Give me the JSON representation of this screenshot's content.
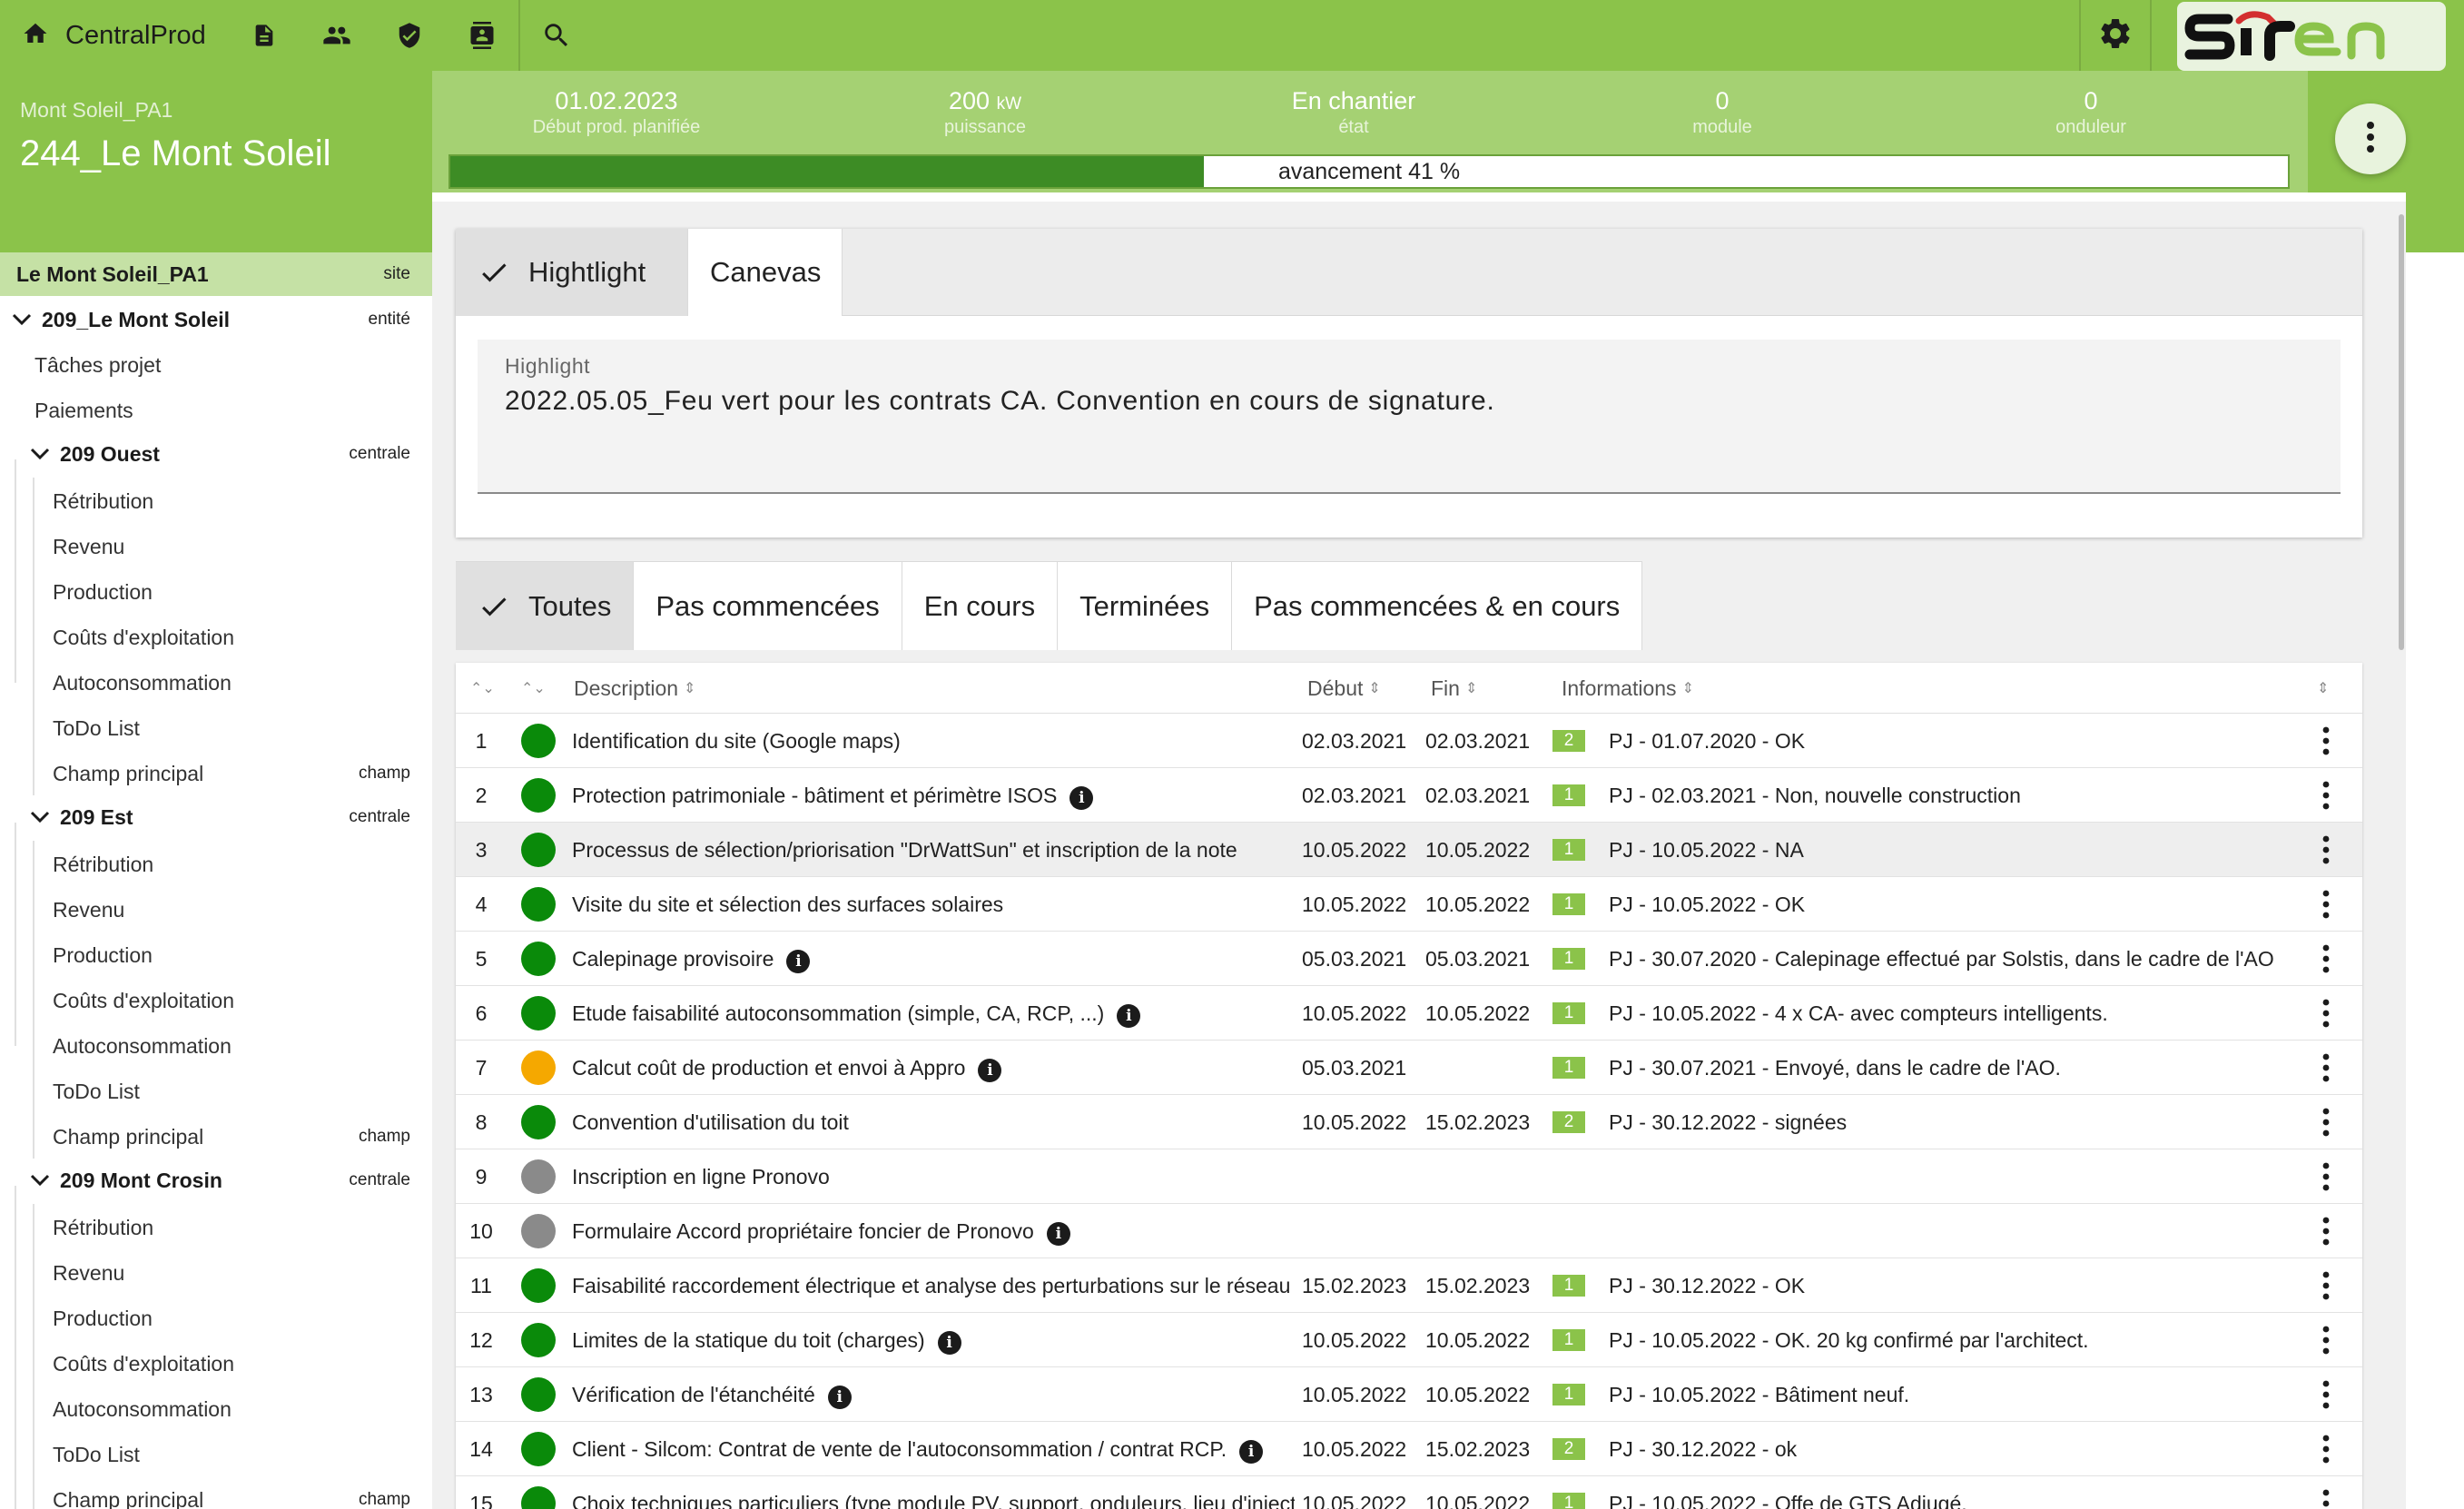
{
  "app": {
    "name": "CentralProd",
    "logo_text": "Siren"
  },
  "header": {
    "subtitle": "Mont Soleil_PA1",
    "title": "244_Le Mont Soleil"
  },
  "stats": [
    {
      "value": "01.02.2023",
      "unit": "",
      "label": "Début prod. planifiée"
    },
    {
      "value": "200",
      "unit": "kW",
      "label": "puissance"
    },
    {
      "value": "En chantier",
      "unit": "",
      "label": "état"
    },
    {
      "value": "0",
      "unit": "",
      "label": "module"
    },
    {
      "value": "0",
      "unit": "",
      "label": "onduleur"
    }
  ],
  "progress": {
    "label": "avancement 41 %",
    "value": 0.41
  },
  "sidebar": {
    "site": {
      "label": "Le Mont Soleil_PA1",
      "tag": "site"
    },
    "entity": {
      "label": "209_Le Mont Soleil",
      "tag": "entité"
    },
    "entity_items": [
      "Tâches projet",
      "Paiements"
    ],
    "centrales": [
      {
        "label": "209 Ouest",
        "tag": "centrale",
        "items": [
          "Rétribution",
          "Revenu",
          "Production",
          "Coûts d'exploitation",
          "Autoconsommation",
          "ToDo List"
        ],
        "champ": {
          "label": "Champ principal",
          "tag": "champ"
        }
      },
      {
        "label": "209 Est",
        "tag": "centrale",
        "items": [
          "Rétribution",
          "Revenu",
          "Production",
          "Coûts d'exploitation",
          "Autoconsommation",
          "ToDo List"
        ],
        "champ": {
          "label": "Champ principal",
          "tag": "champ"
        }
      },
      {
        "label": "209 Mont Crosin",
        "tag": "centrale",
        "items": [
          "Rétribution",
          "Revenu",
          "Production",
          "Coûts d'exploitation",
          "Autoconsommation",
          "ToDo List"
        ],
        "champ": {
          "label": "Champ principal",
          "tag": "champ"
        }
      }
    ]
  },
  "highlight_tabs": {
    "hightlight": "Hightlight",
    "canevas": "Canevas"
  },
  "highlight": {
    "label": "Highlight",
    "value": "2022.05.05_Feu vert pour les contrats CA. Convention en cours de signature."
  },
  "filter_tabs": [
    "Toutes",
    "Pas commencées",
    "En cours",
    "Terminées",
    "Pas commencées & en cours"
  ],
  "table": {
    "headers": {
      "description": "Description",
      "debut": "Début",
      "fin": "Fin",
      "informations": "Informations"
    },
    "status_colors": {
      "done": "#0a8a0a",
      "in_progress": "#f5a800",
      "not_started": "#8a8a8a"
    },
    "rows": [
      {
        "num": "1",
        "status": "done",
        "description": "Identification du site (Google maps)",
        "info_icon": false,
        "debut": "02.03.2021",
        "fin": "02.03.2021",
        "badge": "2",
        "info": "PJ - 01.07.2020 - OK"
      },
      {
        "num": "2",
        "status": "done",
        "description": "Protection patrimoniale - bâtiment et périmètre ISOS",
        "info_icon": true,
        "debut": "02.03.2021",
        "fin": "02.03.2021",
        "badge": "1",
        "info": "PJ - 02.03.2021 - Non, nouvelle construction"
      },
      {
        "num": "3",
        "status": "done",
        "description": "Processus de sélection/priorisation \"DrWattSun\" et inscription de la note",
        "info_icon": false,
        "debut": "10.05.2022",
        "fin": "10.05.2022",
        "badge": "1",
        "info": "PJ - 10.05.2022 - NA"
      },
      {
        "num": "4",
        "status": "done",
        "description": "Visite du site et sélection des surfaces solaires",
        "info_icon": false,
        "debut": "10.05.2022",
        "fin": "10.05.2022",
        "badge": "1",
        "info": "PJ - 10.05.2022 - OK"
      },
      {
        "num": "5",
        "status": "done",
        "description": "Calepinage provisoire",
        "info_icon": true,
        "debut": "05.03.2021",
        "fin": "05.03.2021",
        "badge": "1",
        "info": "PJ - 30.07.2020 - Calepinage effectué par Solstis, dans le cadre de l'AO"
      },
      {
        "num": "6",
        "status": "done",
        "description": "Etude faisabilité autoconsommation (simple, CA, RCP, ...)",
        "info_icon": true,
        "debut": "10.05.2022",
        "fin": "10.05.2022",
        "badge": "1",
        "info": "PJ - 10.05.2022 - 4 x CA- avec compteurs intelligents."
      },
      {
        "num": "7",
        "status": "in_progress",
        "description": "Calcut coût de production et envoi à Appro",
        "info_icon": true,
        "debut": "05.03.2021",
        "fin": "",
        "badge": "1",
        "info": "PJ - 30.07.2021 - Envoyé, dans le cadre de l'AO."
      },
      {
        "num": "8",
        "status": "done",
        "description": "Convention d'utilisation du toit",
        "info_icon": false,
        "debut": "10.05.2022",
        "fin": "15.02.2023",
        "badge": "2",
        "info": "PJ - 30.12.2022 - signées"
      },
      {
        "num": "9",
        "status": "not_started",
        "description": "Inscription en ligne Pronovo",
        "info_icon": false,
        "debut": "",
        "fin": "",
        "badge": "",
        "info": ""
      },
      {
        "num": "10",
        "status": "not_started",
        "description": "Formulaire Accord propriétaire foncier de Pronovo",
        "info_icon": true,
        "debut": "",
        "fin": "",
        "badge": "",
        "info": ""
      },
      {
        "num": "11",
        "status": "done",
        "description": "Faisabilité raccordement électrique et analyse des perturbations sur le réseau é",
        "info_icon": false,
        "debut": "15.02.2023",
        "fin": "15.02.2023",
        "badge": "1",
        "info": "PJ - 30.12.2022 - OK"
      },
      {
        "num": "12",
        "status": "done",
        "description": "Limites de la statique du toit (charges)",
        "info_icon": true,
        "debut": "10.05.2022",
        "fin": "10.05.2022",
        "badge": "1",
        "info": "PJ - 10.05.2022 - OK. 20 kg confirmé par l'architect."
      },
      {
        "num": "13",
        "status": "done",
        "description": "Vérification de l'étanchéité",
        "info_icon": true,
        "debut": "10.05.2022",
        "fin": "10.05.2022",
        "badge": "1",
        "info": "PJ - 10.05.2022 - Bâtiment neuf."
      },
      {
        "num": "14",
        "status": "done",
        "description": "Client - Silcom: Contrat de vente de l'autoconsommation / contrat RCP.",
        "info_icon": true,
        "debut": "10.05.2022",
        "fin": "15.02.2023",
        "badge": "2",
        "info": "PJ - 30.12.2022 - ok"
      },
      {
        "num": "15",
        "status": "done",
        "description": "Choix techniques particuliers (type module PV, support, onduleurs, lieu d'injectio",
        "info_icon": false,
        "debut": "10.05.2022",
        "fin": "10.05.2022",
        "badge": "1",
        "info": "PJ - 10.05.2022 - Offe de GTS Adjugé."
      }
    ]
  }
}
